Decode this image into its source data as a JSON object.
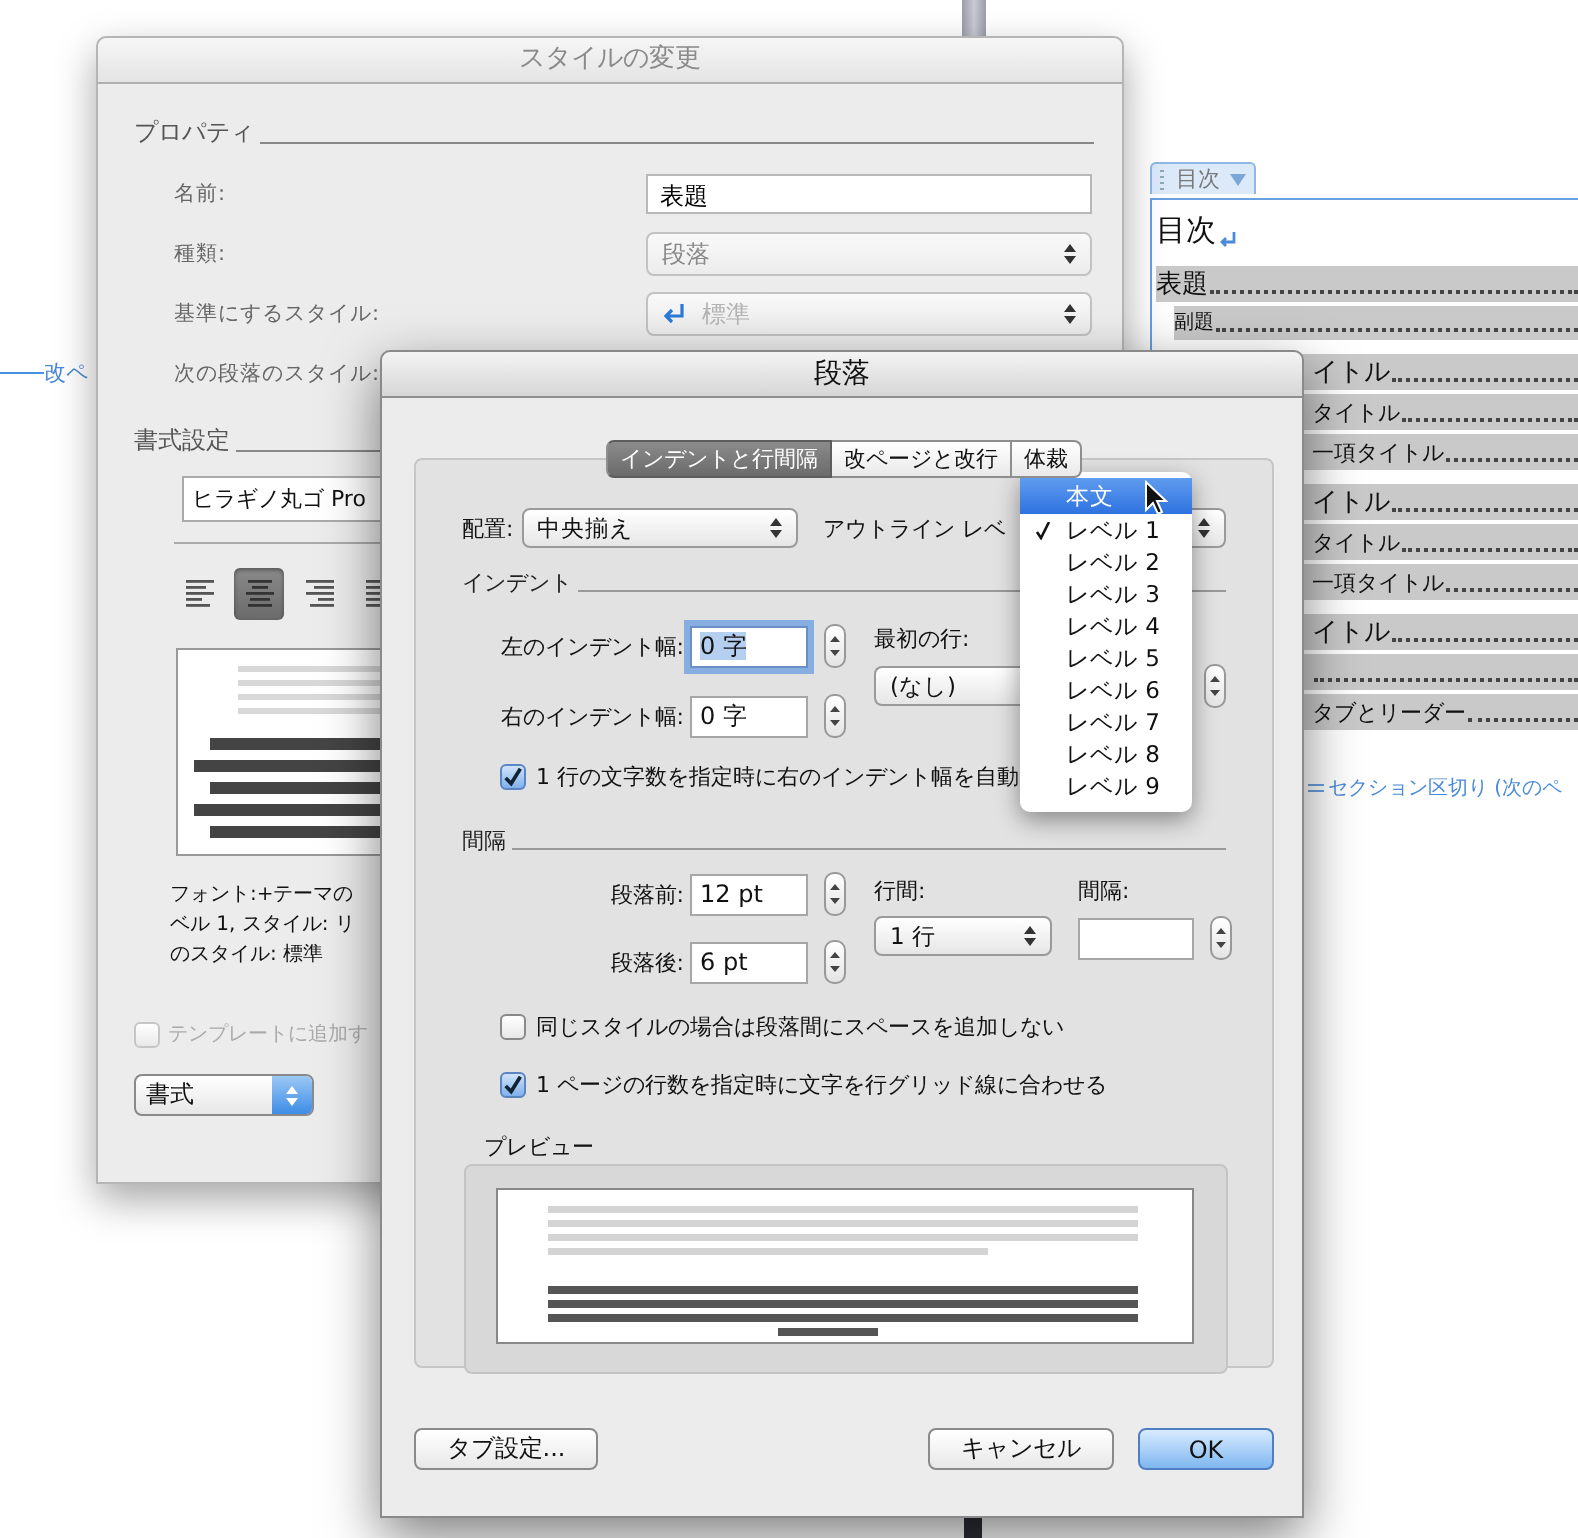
{
  "document": {
    "page_break_label": "改ペ",
    "toc_control_tag": "目次",
    "toc_heading": "目次",
    "toc_entries": [
      {
        "kind": "title",
        "text": "表題"
      },
      {
        "kind": "subtitle",
        "text": "副題"
      },
      {
        "kind": "heading1",
        "text": "イトル"
      },
      {
        "kind": "heading2",
        "text": "タイトル"
      },
      {
        "kind": "heading3",
        "text": "一項タイトル"
      },
      {
        "kind": "heading1",
        "text": "イトル"
      },
      {
        "kind": "heading2",
        "text": "タイトル"
      },
      {
        "kind": "heading3",
        "text": "一項タイトル"
      },
      {
        "kind": "heading1",
        "text": "イトル"
      },
      {
        "kind": "heading2"
      },
      {
        "kind": "heading2",
        "text": "タブとリーダー"
      }
    ],
    "section_break": "セクション区切り (次のペ"
  },
  "style_dialog": {
    "title": "スタイルの変更",
    "properties_heading": "プロパティ",
    "fields": [
      {
        "label": "名前:",
        "kind": "text",
        "value": "表題"
      },
      {
        "label": "種類:",
        "kind": "select",
        "value": "段落",
        "disabled": true
      },
      {
        "label": "基準にするスタイル:",
        "kind": "style_select",
        "value": "標準",
        "disabled": true
      },
      {
        "label": "次の段落のスタイル:",
        "kind": "covered"
      }
    ],
    "format_heading": "書式設定",
    "font": "ヒラギノ丸ゴ Pro",
    "alignment_buttons": [
      {
        "kind": "left",
        "selected": false
      },
      {
        "kind": "center",
        "selected": true
      },
      {
        "kind": "right",
        "selected": false
      },
      {
        "kind": "justify",
        "selected": false
      }
    ],
    "description_lines": [
      "フォント:+テーマの",
      "ベル 1, スタイル: リ",
      "のスタイル: 標準"
    ],
    "add_to_template": {
      "label": "テンプレートに追加す",
      "checked": false,
      "disabled": true
    },
    "format_menu": "書式"
  },
  "paragraph_dialog": {
    "title": "段落",
    "tabs": [
      {
        "label": "インデントと行間隔",
        "selected": true
      },
      {
        "label": "改ページと改行",
        "selected": false
      },
      {
        "label": "体裁",
        "selected": false
      }
    ],
    "alignment": {
      "label": "配置:",
      "value": "中央揃え"
    },
    "outline_level_label": "アウトライン レベ",
    "indent": {
      "heading": "インデント",
      "left": {
        "label": "左のインデント幅:",
        "value": "0 字",
        "focused": true
      },
      "right": {
        "label": "右のインデント幅:",
        "value": "0 字",
        "focused": false
      },
      "first_line": {
        "label": "最初の行:",
        "value": "(なし)"
      },
      "auto_adjust": {
        "label": "1 行の文字数を指定時に右のインデント幅を自動",
        "checked": true
      }
    },
    "spacing": {
      "heading": "間隔",
      "before": {
        "label": "段落前:",
        "value": "12 pt"
      },
      "after": {
        "label": "段落後:",
        "value": "6 pt"
      },
      "line_spacing": {
        "label": "行間:",
        "value": "1 行"
      },
      "at": {
        "label": "間隔:"
      }
    },
    "options": [
      {
        "label": "同じスタイルの場合は段落間にスペースを追加しない",
        "checked": false
      },
      {
        "label": "1 ページの行数を指定時に文字を行グリッド線に合わせる",
        "checked": true
      }
    ],
    "preview_heading": "プレビュー",
    "buttons": [
      {
        "label": "タブ設定...",
        "default": false
      },
      {
        "label": "キャンセル",
        "default": false
      },
      {
        "label": "OK",
        "default": true
      }
    ]
  },
  "outline_menu": {
    "items": [
      {
        "label": "本文",
        "highlighted": true,
        "checked": false
      },
      {
        "label": "レベル 1",
        "highlighted": false,
        "checked": true
      },
      {
        "label": "レベル 2",
        "highlighted": false,
        "checked": false
      },
      {
        "label": "レベル 3",
        "highlighted": false,
        "checked": false
      },
      {
        "label": "レベル 4",
        "highlighted": false,
        "checked": false
      },
      {
        "label": "レベル 5",
        "highlighted": false,
        "checked": false
      },
      {
        "label": "レベル 6",
        "highlighted": false,
        "checked": false
      },
      {
        "label": "レベル 7",
        "highlighted": false,
        "checked": false
      },
      {
        "label": "レベル 8",
        "highlighted": false,
        "checked": false
      },
      {
        "label": "レベル 9",
        "highlighted": false,
        "checked": false
      }
    ]
  }
}
